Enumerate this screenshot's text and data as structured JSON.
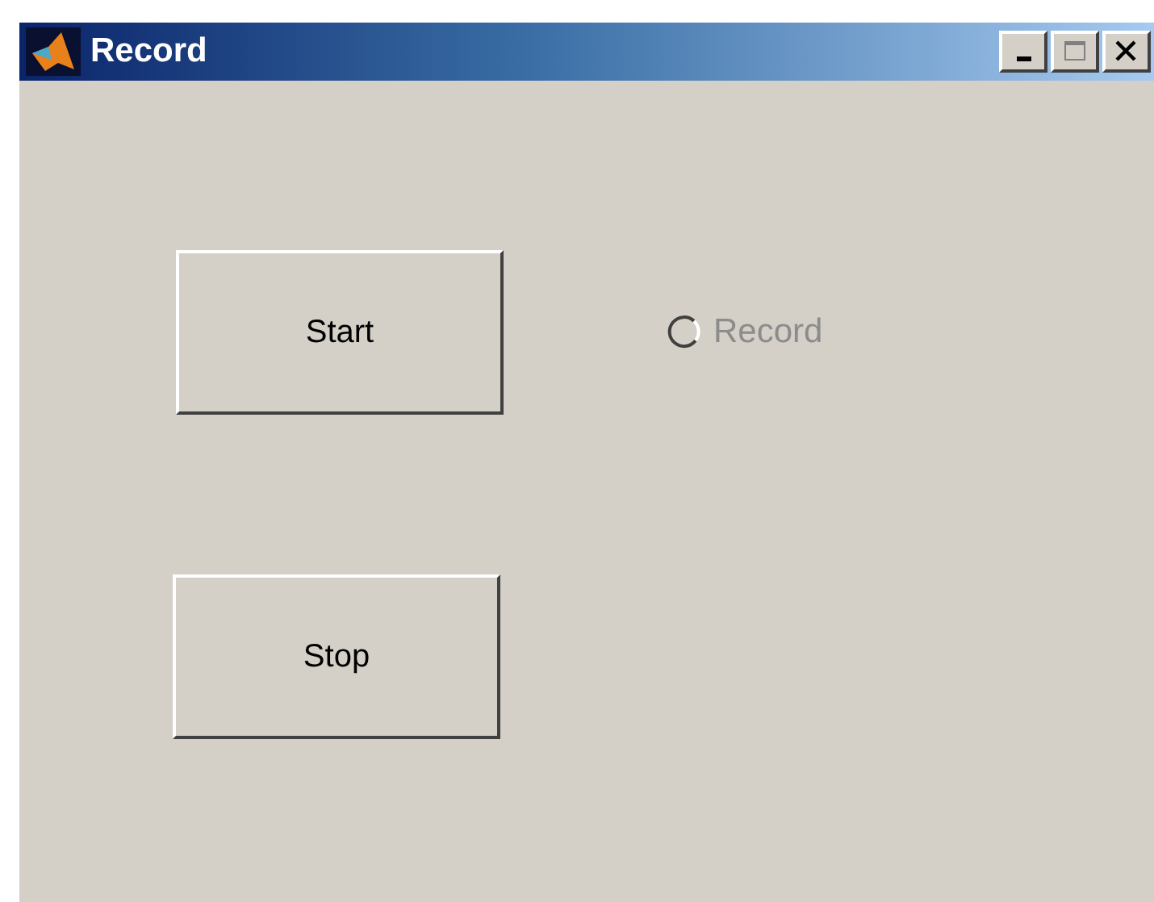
{
  "window": {
    "title": "Record",
    "controls": [
      {
        "kind": "minimize",
        "disabled": false
      },
      {
        "kind": "maximize",
        "disabled": true
      },
      {
        "kind": "close",
        "disabled": false
      }
    ]
  },
  "buttons": [
    {
      "label": "Start"
    },
    {
      "label": "Stop"
    }
  ],
  "radio": {
    "label": "Record",
    "selected": false,
    "disabled": true
  }
}
